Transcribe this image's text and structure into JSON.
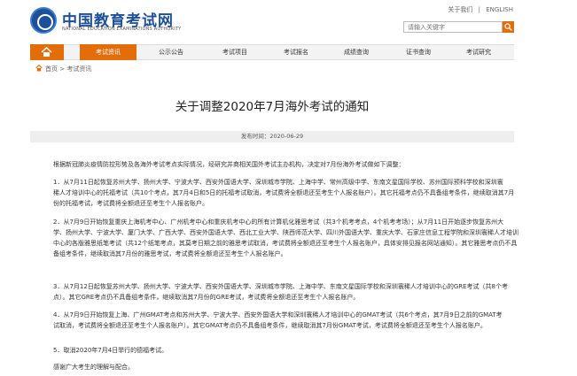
{
  "header": {
    "site_title": "中国教育考试网",
    "site_subtitle": "NATIONAL EDUCATION EXAMINATIONS AUTHORITY",
    "top_links": [
      "关于我们",
      "|",
      "ENGLISH"
    ],
    "search_placeholder": "请输入关键字"
  },
  "nav": {
    "items": [
      "考试资讯",
      "公示公告",
      "考试项目",
      "考试报名",
      "成绩查询",
      "证书查询",
      "考试研究"
    ],
    "active_index": 0
  },
  "breadcrumb": {
    "home": "首页",
    "sep": ">",
    "current": "考试资讯"
  },
  "article": {
    "title": "关于调整2020年7月海外考试的通知",
    "publish_label": "发布时间：2020-06-29",
    "paragraphs": [
      [
        "根据新冠肺炎疫情防控形势及各海外考试考点实际情况，经研究并商相关国外考试主办机构，决定对7月份海外考试做如下调整："
      ],
      [
        "1．从7月11日起恢复苏州大学、扬州大学、宁波大学、西安外国语大学、深圳城市学院、上海中学、常州高级中学、东南文星国际学校、苏州国际预科学校和深圳寰",
        "稀人才培训中心的托福考试（共10个考点，其7月4日和5日的托福考试取消，考试费将全额退还至考生个人报名账户）。其它托福考点仍不具备组考条件，继续取消其7月",
        "份的托福考试，考试费将全额退还至考生个人报名账户。"
      ],
      [
        "2．从7月9日开始恢复重庆上海机考中心、广州机考中心和重庆机考中心的所有计算机化雅思考试（共3个机考考点，4个机考考场）；从7月11日开始逐步恢复苏州大",
        "学、扬州大学、宁波大学、厦门大学、广西大学、西安外国语大学、西北工业大学、陕西师范大学、四川外国语大学、重庆大学、石家庄信息工程学院和深圳寰稀人才培训",
        "中心的各版雅思纸笔考试（共12个纸笔考点，其莫考日期之前的雅思考试取消，考试费将全额退还至考生个人报名账户，具体安排见报名网站通知）。其它雅思考点仍不具",
        "备组考条件，继续取消其7月份的雅思考试，考试费将全额退还至考生个人报名账户。"
      ],
      [
        "3．从7月12日起恢复苏州大学、扬州大学、宁波大学、西安外国语大学、深圳城市学院、上海中学、东南文星国际学校和深圳寰稀人才培训中心的GRE考试（共8个考",
        "点）。其它GRE考点仍不具备组考条件，继续取消其7月份的GRE考试，考试费将全额退还至考生个人报名账户。"
      ],
      [
        "4．从7月9日开始恢复上海、广州GMAT考点和苏州大学、宁波大学、西安外国语大学和深圳寰稀人才培训中心的GMAT考试（共6个考点，其7月9日之前的GMAT考",
        "试取消，考试费将全额退还至考生个人报名账户）。其它GMAT考点仍不具备组考条件，继续取消其7月份GMAT考试，考试费将全额退还至考生个人报名账户。"
      ],
      [
        "5．取消2020年7月4日举行的德福考试。"
      ],
      [
        "感谢广大考生的理解与配合。"
      ]
    ]
  },
  "colors": {
    "accent": "#e36d09",
    "brand": "#1d4f9a"
  }
}
